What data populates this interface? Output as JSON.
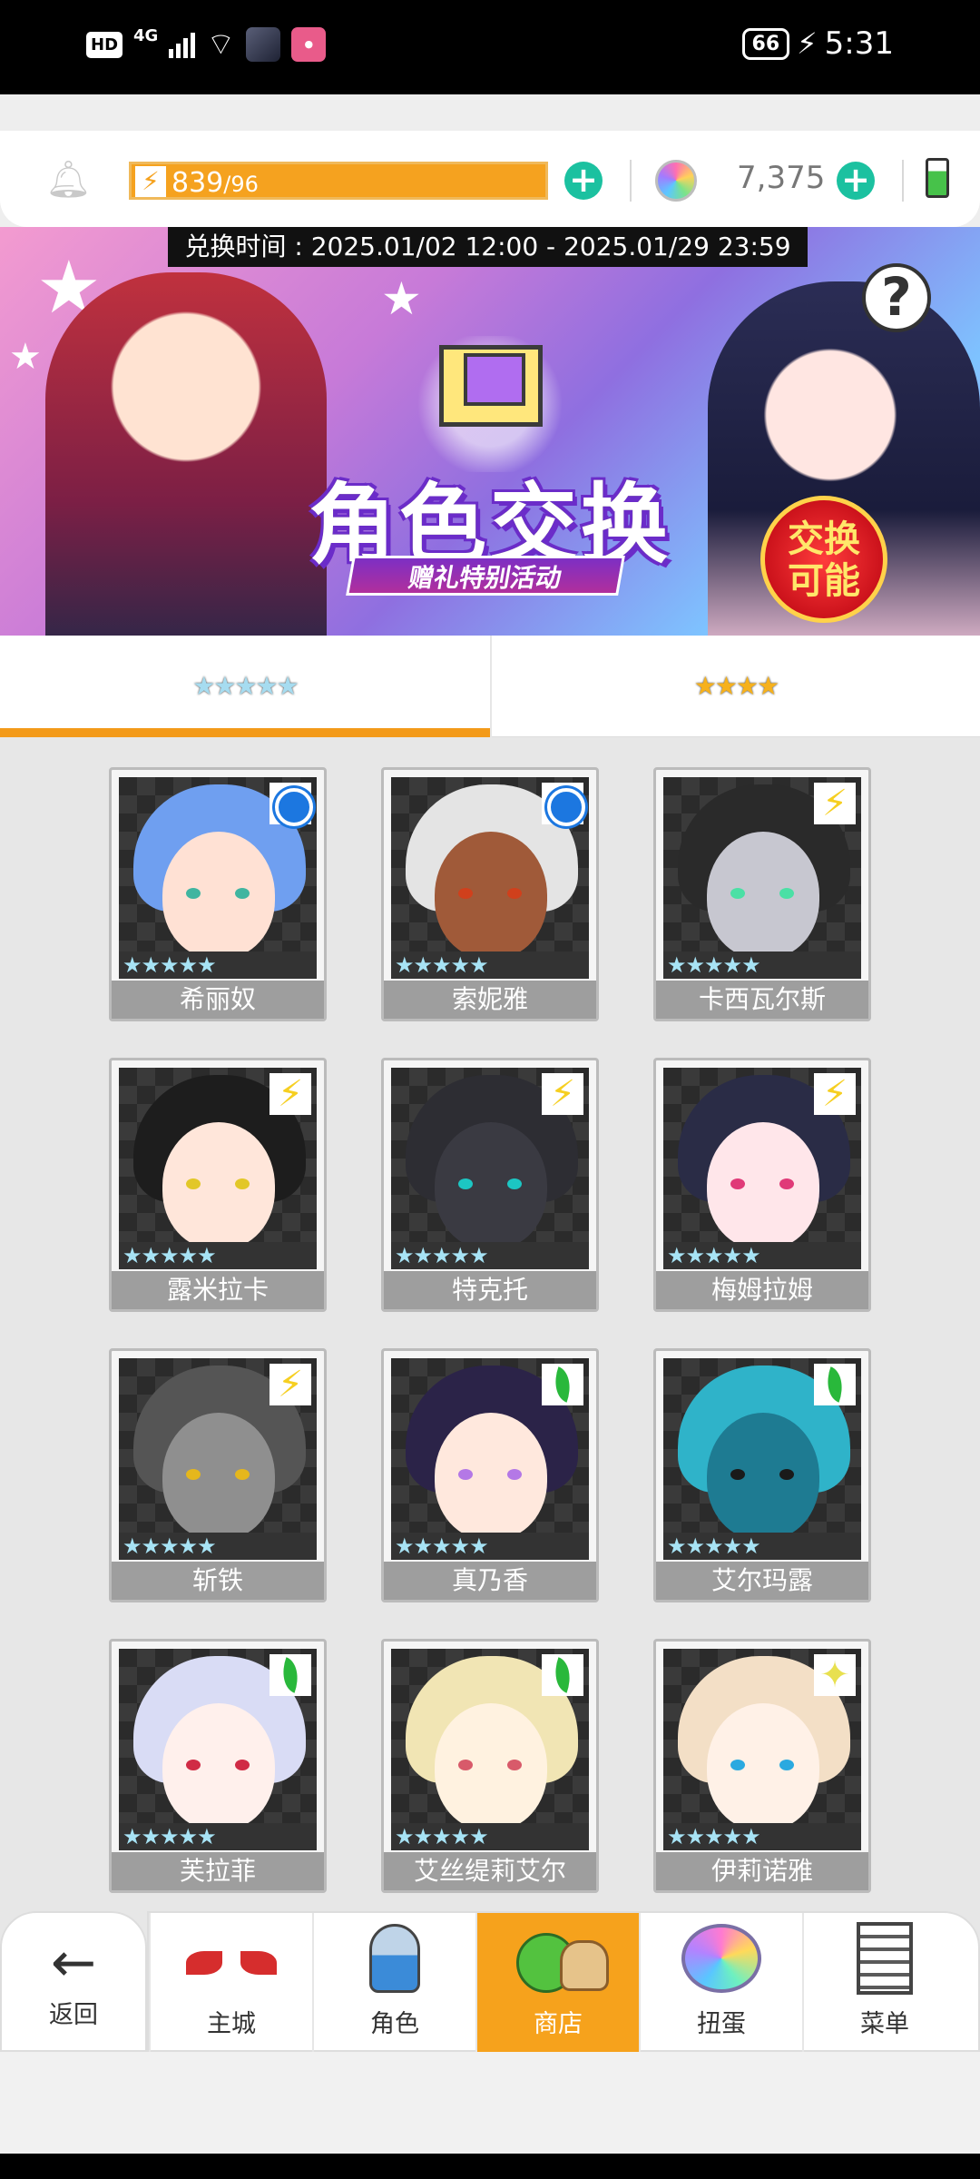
{
  "status_bar": {
    "hd": "HD",
    "network": "4G",
    "battery_level": "66",
    "time": "5:31",
    "icons": [
      "signal-icon",
      "wifi-icon",
      "app-notification-icon",
      "charging-icon"
    ]
  },
  "resources": {
    "stamina_current": "839",
    "stamina_max": "/96",
    "gems": "7,375"
  },
  "banner": {
    "exchange_time": "兑换时间 : 2025.01/02 12:00 - 2025.01/29 23:59",
    "title": "角色交换",
    "subtitle": "赠礼特别活动",
    "badge_line1": "交换",
    "badge_line2": "可能",
    "help_symbol": "?"
  },
  "tabs": [
    {
      "label": "★★★★★",
      "active": true
    },
    {
      "label": "★★★★",
      "active": false
    }
  ],
  "characters": [
    {
      "name": "希丽奴",
      "element": "water",
      "stars": "★★★★★",
      "hair": "#6f9ff0",
      "skin": "#ffe1d4",
      "eye": "#40b5a0"
    },
    {
      "name": "索妮雅",
      "element": "water",
      "stars": "★★★★★",
      "hair": "#e4e4e4",
      "skin": "#a05a39",
      "eye": "#d0401c"
    },
    {
      "name": "卡西瓦尔斯",
      "element": "thunder",
      "stars": "★★★★★",
      "hair": "#2a2a2a",
      "skin": "#c7c7d0",
      "eye": "#4be0a5"
    },
    {
      "name": "露米拉卡",
      "element": "thunder",
      "stars": "★★★★★",
      "hair": "#1d1d1d",
      "skin": "#ffe6da",
      "eye": "#e2c728"
    },
    {
      "name": "特克托",
      "element": "thunder",
      "stars": "★★★★★",
      "hair": "#2d2d33",
      "skin": "#3a3a42",
      "eye": "#1cc6c3"
    },
    {
      "name": "梅姆拉姆",
      "element": "thunder",
      "stars": "★★★★★",
      "hair": "#2a2c46",
      "skin": "#ffe6ea",
      "eye": "#e03a78"
    },
    {
      "name": "斩铁",
      "element": "thunder",
      "stars": "★★★★★",
      "hair": "#555555",
      "skin": "#8f8f8f",
      "eye": "#e5b71c"
    },
    {
      "name": "真乃香",
      "element": "wind",
      "stars": "★★★★★",
      "hair": "#2b2348",
      "skin": "#ffe8dd",
      "eye": "#b478e6"
    },
    {
      "name": "艾尔玛露",
      "element": "wind",
      "stars": "★★★★★",
      "hair": "#2fb3c9",
      "skin": "#1e7b92",
      "eye": "#1a1a1a"
    },
    {
      "name": "芙拉菲",
      "element": "wind",
      "stars": "★★★★★",
      "hair": "#d9dcf5",
      "skin": "#fff0ec",
      "eye": "#d02b45"
    },
    {
      "name": "艾丝缇莉艾尔",
      "element": "wind",
      "stars": "★★★★★",
      "hair": "#f1e5b4",
      "skin": "#fff2e0",
      "eye": "#d85a6a"
    },
    {
      "name": "伊莉诺雅",
      "element": "light",
      "stars": "★★★★★",
      "hair": "#f3dfc6",
      "skin": "#fff1e7",
      "eye": "#2aa9e0"
    }
  ],
  "nav": {
    "back_label": "返回",
    "items": [
      {
        "label": "主城",
        "icon": "town-icon",
        "active": false
      },
      {
        "label": "角色",
        "icon": "hero-icon",
        "active": false
      },
      {
        "label": "商店",
        "icon": "shop-icon",
        "active": true
      },
      {
        "label": "扭蛋",
        "icon": "gacha-icon",
        "active": false
      },
      {
        "label": "菜单",
        "icon": "menu-icon",
        "active": false
      }
    ]
  },
  "colors": {
    "accent_orange": "#f39a19",
    "plus_green": "#1bc1a0",
    "card_name_bg": "#9e9e9e"
  }
}
